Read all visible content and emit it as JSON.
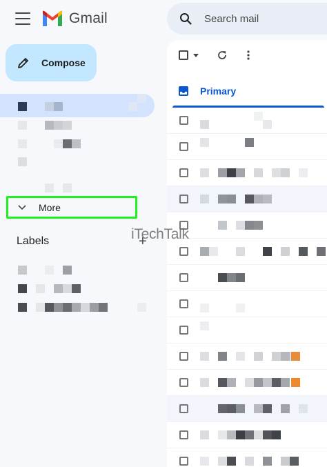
{
  "app": {
    "name": "Gmail"
  },
  "compose": {
    "label": "Compose"
  },
  "nav": {
    "more_label": "More"
  },
  "labels": {
    "heading": "Labels",
    "add_symbol": "+"
  },
  "search": {
    "placeholder": "Search mail"
  },
  "tabs": [
    {
      "label": "Primary"
    }
  ],
  "watermark": "iTechTalk",
  "colors": {
    "accent": "#0b57d0",
    "compose_bg": "#c2e7ff",
    "nav_active": "#d3e3fd",
    "highlight_box": "#1ef21e",
    "background": "#f6f8fc"
  },
  "icons": [
    "menu-icon",
    "gmail-logo",
    "pencil-icon",
    "chevron-down-icon",
    "plus-icon",
    "search-icon",
    "checkbox-icon",
    "dropdown-caret-icon",
    "refresh-icon",
    "more-vert-icon",
    "inbox-icon"
  ]
}
